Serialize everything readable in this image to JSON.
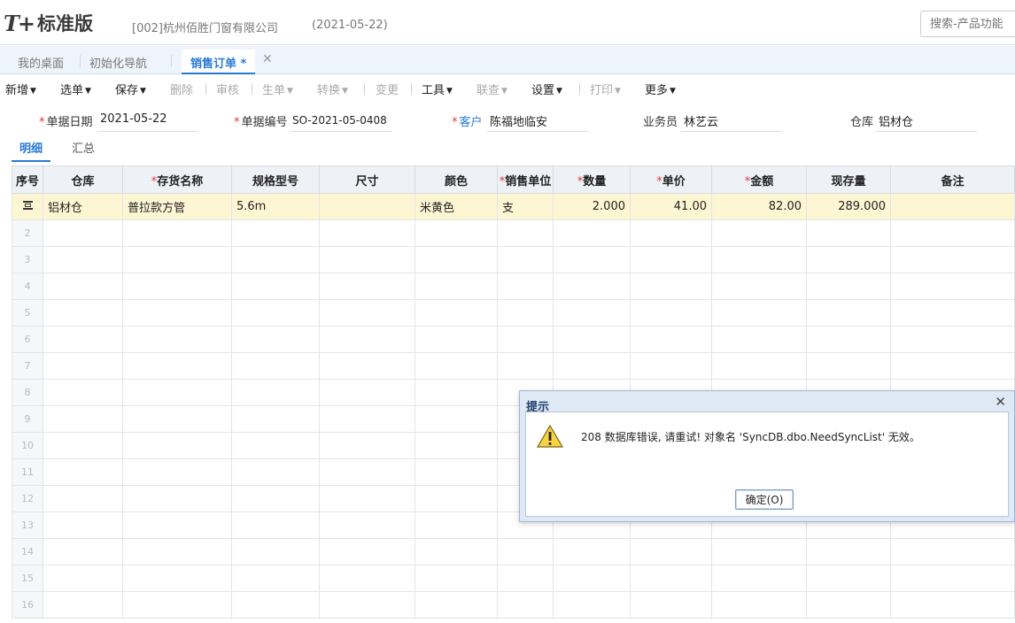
{
  "header": {
    "logo_mark": "T+",
    "logo_text": "标准版",
    "company": "[002]杭州佰胜门窗有限公司",
    "date": "(2021-05-22)",
    "search_placeholder": "搜索-产品功能"
  },
  "tabs": [
    {
      "label": "我的桌面"
    },
    {
      "label": "初始化导航"
    },
    {
      "label": "销售订单 *",
      "active": true
    }
  ],
  "toolbar": {
    "new": "新增",
    "select": "选单",
    "save": "保存",
    "delete": "删除",
    "audit": "审核",
    "generate": "生单",
    "convert": "转换",
    "change": "变更",
    "tools": "工具",
    "query": "联查",
    "settings": "设置",
    "print": "打印",
    "more": "更多"
  },
  "form": {
    "doc_date_label": "单据日期",
    "doc_date": "2021-05-22",
    "doc_no_label": "单据编号",
    "doc_no": "SO-2021-05-0408",
    "customer_label": "客户",
    "customer": "陈福地临安",
    "salesperson_label": "业务员",
    "salesperson": "林艺云",
    "warehouse_label": "仓库",
    "warehouse": "铝材仓"
  },
  "subtabs": {
    "detail": "明细",
    "summary": "汇总"
  },
  "grid": {
    "headers": [
      "序号",
      "仓库",
      "存货名称",
      "规格型号",
      "尺寸",
      "颜色",
      "销售单位",
      "数量",
      "单价",
      "金额",
      "现存量",
      "备注"
    ],
    "row1": {
      "warehouse": "铝材仓",
      "item_name": "普拉款方管",
      "spec": "5.6m",
      "size": "",
      "color": "米黄色",
      "unit": "支",
      "qty": "2.000",
      "price": "41.00",
      "amount": "82.00",
      "stock": "289.000",
      "remark": ""
    },
    "row_numbers": [
      "2",
      "3",
      "4",
      "5",
      "6",
      "7",
      "8",
      "9",
      "10",
      "11",
      "12",
      "13",
      "14",
      "15",
      "16"
    ]
  },
  "dialog": {
    "title": "提示",
    "message": "208 数据库错误, 请重试! 对象名 'SyncDB.dbo.NeedSyncList' 无效。",
    "ok_label": "确定(O)"
  }
}
